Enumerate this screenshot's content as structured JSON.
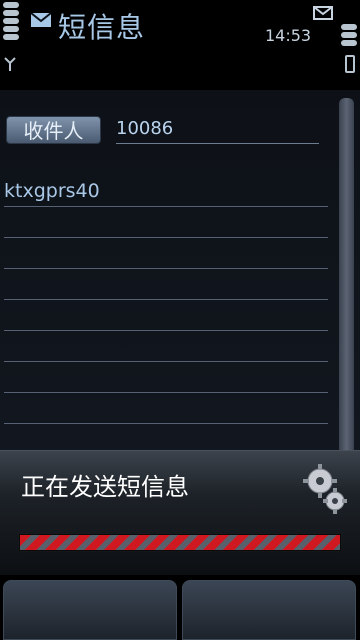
{
  "header": {
    "app_title": "短信息",
    "time": "14:53",
    "icons": [
      "signal-bars-icon",
      "antenna-icon",
      "envelope-icon",
      "envelope-small-icon",
      "battery-bars-icon",
      "battery-icon"
    ]
  },
  "compose": {
    "recipient_label": "收件人",
    "recipient_value": "10086",
    "message_text": "ktxgprs40"
  },
  "dialog": {
    "text": "正在发送短信息",
    "icon": "gears-icon",
    "accent_colors": [
      "#d01820",
      "#58616b"
    ]
  },
  "softkeys": {
    "left_label": "",
    "right_label": ""
  }
}
